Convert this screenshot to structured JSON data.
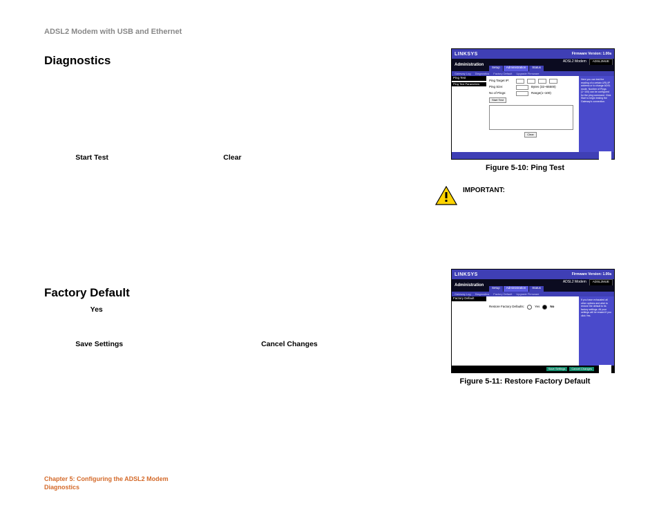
{
  "header": "ADSL2 Modem with USB and Ethernet",
  "section1": {
    "title": "Diagnostics",
    "start_test": "Start Test",
    "clear": "Clear"
  },
  "section2": {
    "title": "Factory Default",
    "yes": "Yes",
    "save_settings": "Save Settings",
    "cancel_changes": "Cancel Changes"
  },
  "important": {
    "label": "IMPORTANT:"
  },
  "figure1": {
    "caption": "Figure 5-10: Ping Test",
    "logo": "LINKSYS",
    "fw": "Firmware Version: 1.00a",
    "model_label": "ADSL2 Modem",
    "model": "ADSL2MUE",
    "admin": "Administration",
    "tabs": [
      "Setup",
      "Administration",
      "Status"
    ],
    "subtabs": [
      "Gateway Log",
      "Diagnostics",
      "Factory Default",
      "Upgrade Firmware"
    ],
    "side1": "Ping Test",
    "side2": "Ping Test Parameters",
    "fields": {
      "ping_target_lbl": "Ping Target IP:",
      "ping_size_lbl": "Ping Size:",
      "no_pings_lbl": "No of Pings:",
      "bytes": "Bytes (32~65500)",
      "range": "Range(1~100)"
    },
    "start_btn": "Start Test",
    "clear_btn": "Clear",
    "help": "Here you can test the reading of a certain URL/IP address or to change ADSL mode. Number of Pings (1~100) can be configured for the ping command. Click Start to begin testing the Gateway's connection."
  },
  "figure2": {
    "caption": "Figure 5-11: Restore Factory Default",
    "logo": "LINKSYS",
    "fw": "Firmware Version: 1.00a",
    "model_label": "ADSL2 Modem",
    "model": "ADSL2MUE",
    "admin": "Administration",
    "tabs": [
      "Setup",
      "Administration",
      "Status"
    ],
    "subtabs": [
      "Gateway Log",
      "Diagnostics",
      "Factory Default",
      "Upgrade Firmware"
    ],
    "side1": "Factory Default",
    "restore_lbl": "Restore Factory Defaults:",
    "opt_yes": "Yes",
    "opt_no": "No",
    "save": "Save Settings",
    "cancel": "Cancel Changes",
    "help": "If you have exhausted all other options and wish to restore the default to its factory settings. All your settings will be erased if you click Yes."
  },
  "footer": {
    "chapter": "Chapter 5: Configuring the ADSL2 Modem",
    "section": "Diagnostics"
  }
}
